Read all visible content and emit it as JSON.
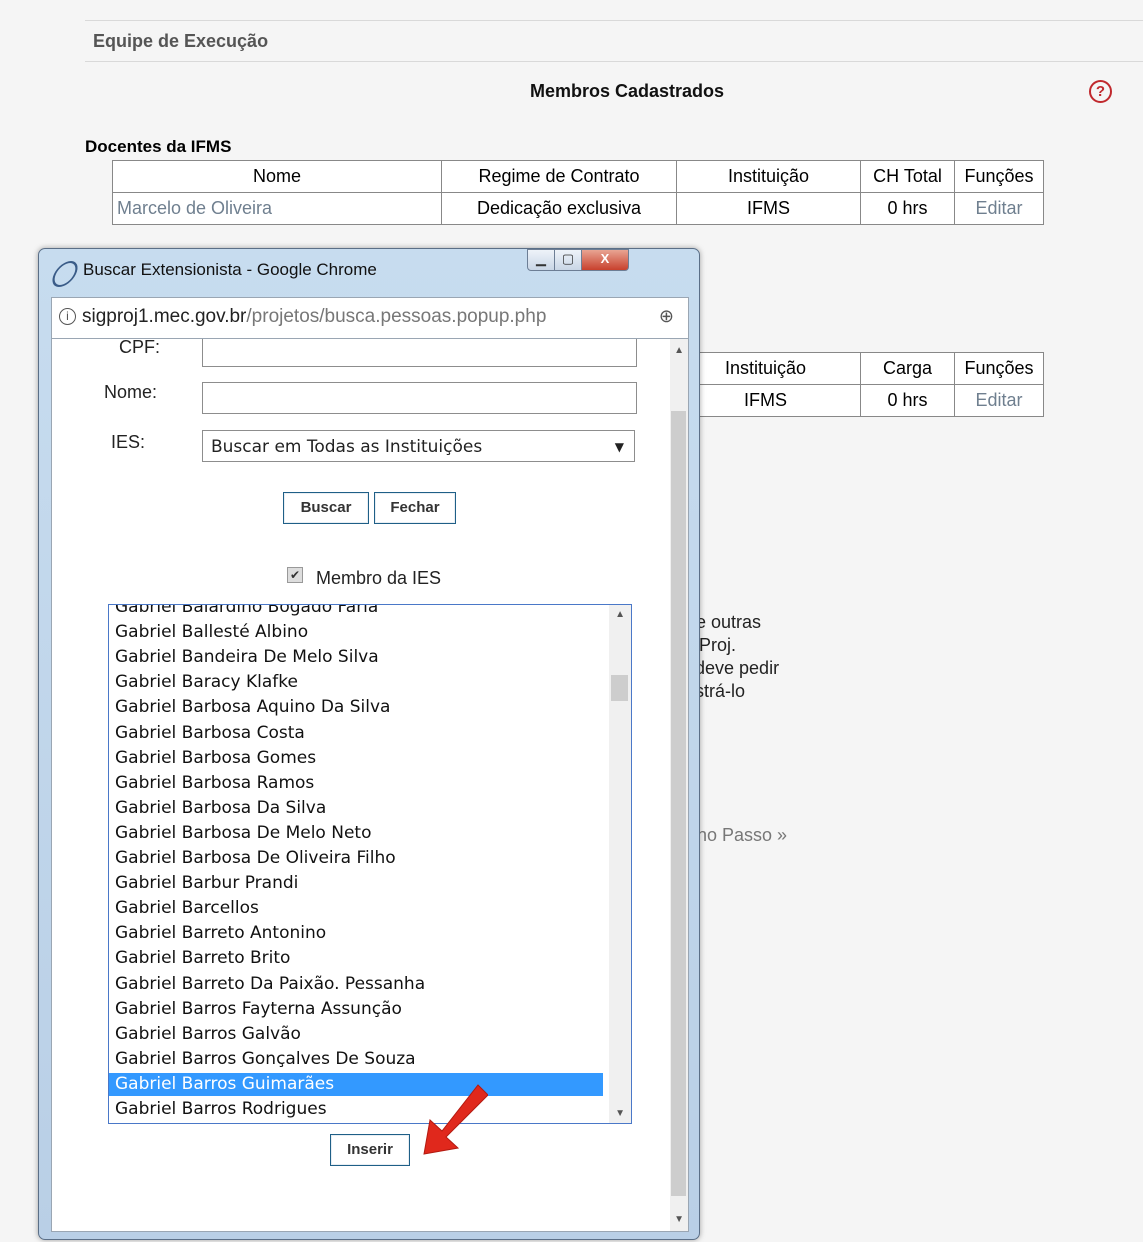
{
  "page": {
    "section_title": "Equipe de Execução",
    "members_title": "Membros Cadastrados",
    "help_symbol": "?",
    "docentes_heading": "Docentes da IFMS",
    "docentes_table": {
      "headers": [
        "Nome",
        "Regime de Contrato",
        "Instituição",
        "CH Total",
        "Funções"
      ],
      "row": {
        "nome": "Marcelo de Oliveira",
        "regime": "Dedicação exclusiva",
        "instituicao": "IFMS",
        "ch": "0 hrs",
        "acao": "Editar"
      }
    },
    "second_table": {
      "headers": [
        "Instituição",
        "Carga",
        "Funções"
      ],
      "row": {
        "instituicao": "IFMS",
        "carga": "0 hrs",
        "acao": "Editar"
      }
    },
    "partial_text_lines": [
      "tre outras",
      "GProj.",
      ", deve pedir",
      "astrá-lo"
    ],
    "next_step": "no Passo »"
  },
  "popup": {
    "window_title": "Buscar Extensionista - Google Chrome",
    "url_host": "sigproj1.mec.gov.br",
    "url_path": "/projetos/busca.pessoas.popup.php",
    "info_symbol": "i",
    "zoom_symbol": "⊕",
    "controls": {
      "min": "▁",
      "max": "▢",
      "close": "X"
    },
    "form": {
      "cpf_label": "CPF:",
      "cpf_value": "",
      "nome_label": "Nome:",
      "nome_value": "",
      "ies_label": "IES:",
      "ies_selected": "Buscar em Todas as Instituições",
      "buscar_button": "Buscar",
      "fechar_button": "Fechar",
      "checkbox_checked": true,
      "checkbox_mark": "✔",
      "checkbox_label": "Membro da IES",
      "inserir_button": "Inserir"
    },
    "list_items": [
      "Gabriel Balardino Bogado Faria",
      "Gabriel Ballesté Albino",
      "Gabriel Bandeira De Melo Silva",
      "Gabriel Baracy Klafke",
      "Gabriel Barbosa Aquino Da Silva",
      "Gabriel Barbosa Costa",
      "Gabriel Barbosa Gomes",
      "Gabriel Barbosa Ramos",
      "Gabriel Barbosa Da Silva",
      "Gabriel Barbosa De Melo Neto",
      "Gabriel Barbosa De Oliveira Filho",
      "Gabriel Barbur Prandi",
      "Gabriel Barcellos",
      "Gabriel Barreto Antonino",
      "Gabriel Barreto Brito",
      "Gabriel Barreto Da Paixão. Pessanha",
      "Gabriel Barros Fayterna Assunção",
      "Gabriel Barros Galvão",
      "Gabriel Barros Gonçalves De Souza",
      "Gabriel Barros Guimarães",
      "Gabriel Barros Rodrigues"
    ],
    "selected_index": 19
  },
  "colors": {
    "selection": "#3399ff",
    "arrow": "#e0281c",
    "help": "#c0282d"
  }
}
